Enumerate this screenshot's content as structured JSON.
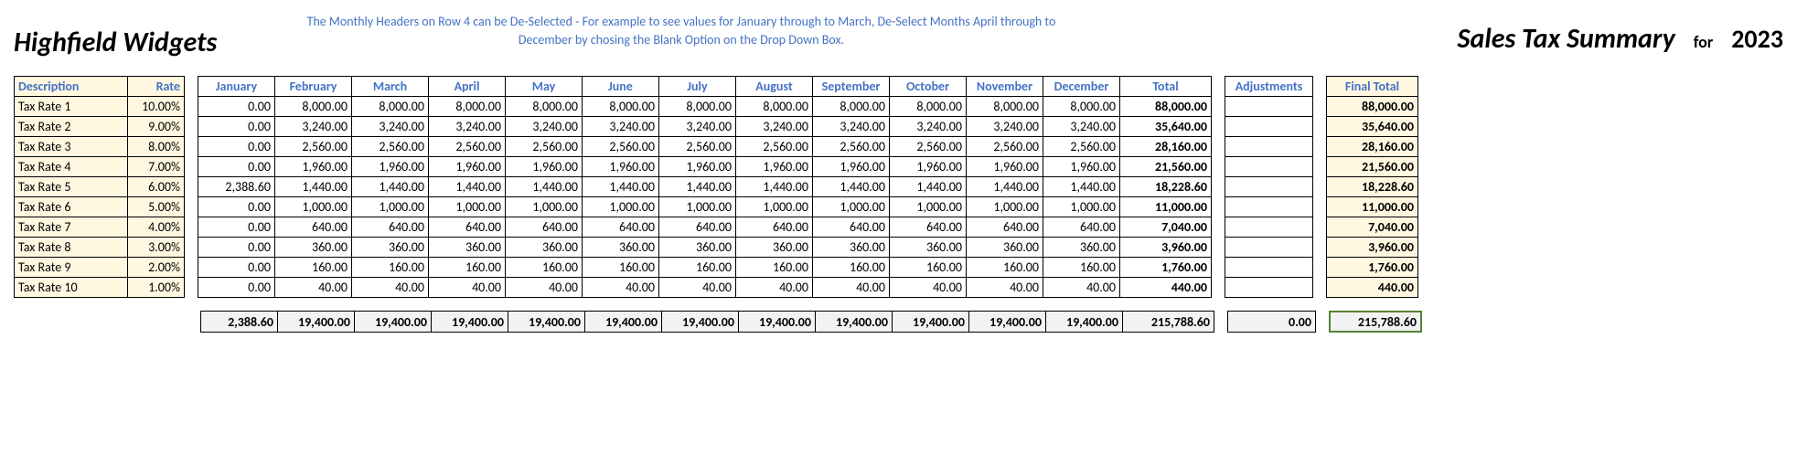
{
  "header": {
    "company": "Highfield Widgets",
    "hint": "The Monthly Headers on Row 4 can be De-Selected - For example to see values for January through to March,  De-Select Months April through to December by chosing the Blank Option on the Drop Down Box.",
    "title": "Sales Tax Summary",
    "for_label": "for",
    "year": "2023"
  },
  "desc_headers": {
    "description": "Description",
    "rate": "Rate"
  },
  "rates": [
    {
      "name": "Tax Rate 1",
      "rate": "10.00%"
    },
    {
      "name": "Tax Rate 2",
      "rate": "9.00%"
    },
    {
      "name": "Tax Rate 3",
      "rate": "8.00%"
    },
    {
      "name": "Tax Rate 4",
      "rate": "7.00%"
    },
    {
      "name": "Tax Rate 5",
      "rate": "6.00%"
    },
    {
      "name": "Tax Rate 6",
      "rate": "5.00%"
    },
    {
      "name": "Tax Rate 7",
      "rate": "4.00%"
    },
    {
      "name": "Tax Rate 8",
      "rate": "3.00%"
    },
    {
      "name": "Tax Rate 9",
      "rate": "2.00%"
    },
    {
      "name": "Tax Rate 10",
      "rate": "1.00%"
    }
  ],
  "month_headers": [
    "January",
    "February",
    "March",
    "April",
    "May",
    "June",
    "July",
    "August",
    "September",
    "October",
    "November",
    "December",
    "Total"
  ],
  "data_rows": [
    [
      "0.00",
      "8,000.00",
      "8,000.00",
      "8,000.00",
      "8,000.00",
      "8,000.00",
      "8,000.00",
      "8,000.00",
      "8,000.00",
      "8,000.00",
      "8,000.00",
      "8,000.00",
      "88,000.00"
    ],
    [
      "0.00",
      "3,240.00",
      "3,240.00",
      "3,240.00",
      "3,240.00",
      "3,240.00",
      "3,240.00",
      "3,240.00",
      "3,240.00",
      "3,240.00",
      "3,240.00",
      "3,240.00",
      "35,640.00"
    ],
    [
      "0.00",
      "2,560.00",
      "2,560.00",
      "2,560.00",
      "2,560.00",
      "2,560.00",
      "2,560.00",
      "2,560.00",
      "2,560.00",
      "2,560.00",
      "2,560.00",
      "2,560.00",
      "28,160.00"
    ],
    [
      "0.00",
      "1,960.00",
      "1,960.00",
      "1,960.00",
      "1,960.00",
      "1,960.00",
      "1,960.00",
      "1,960.00",
      "1,960.00",
      "1,960.00",
      "1,960.00",
      "1,960.00",
      "21,560.00"
    ],
    [
      "2,388.60",
      "1,440.00",
      "1,440.00",
      "1,440.00",
      "1,440.00",
      "1,440.00",
      "1,440.00",
      "1,440.00",
      "1,440.00",
      "1,440.00",
      "1,440.00",
      "1,440.00",
      "18,228.60"
    ],
    [
      "0.00",
      "1,000.00",
      "1,000.00",
      "1,000.00",
      "1,000.00",
      "1,000.00",
      "1,000.00",
      "1,000.00",
      "1,000.00",
      "1,000.00",
      "1,000.00",
      "1,000.00",
      "11,000.00"
    ],
    [
      "0.00",
      "640.00",
      "640.00",
      "640.00",
      "640.00",
      "640.00",
      "640.00",
      "640.00",
      "640.00",
      "640.00",
      "640.00",
      "640.00",
      "7,040.00"
    ],
    [
      "0.00",
      "360.00",
      "360.00",
      "360.00",
      "360.00",
      "360.00",
      "360.00",
      "360.00",
      "360.00",
      "360.00",
      "360.00",
      "360.00",
      "3,960.00"
    ],
    [
      "0.00",
      "160.00",
      "160.00",
      "160.00",
      "160.00",
      "160.00",
      "160.00",
      "160.00",
      "160.00",
      "160.00",
      "160.00",
      "160.00",
      "1,760.00"
    ],
    [
      "0.00",
      "40.00",
      "40.00",
      "40.00",
      "40.00",
      "40.00",
      "40.00",
      "40.00",
      "40.00",
      "40.00",
      "40.00",
      "40.00",
      "440.00"
    ]
  ],
  "adj_header": "Adjustments",
  "adj_rows": [
    "",
    "",
    "",
    "",
    "",
    "",
    "",
    "",
    "",
    ""
  ],
  "final_header": "Final Total",
  "final_rows": [
    "88,000.00",
    "35,640.00",
    "28,160.00",
    "21,560.00",
    "18,228.60",
    "11,000.00",
    "7,040.00",
    "3,960.00",
    "1,760.00",
    "440.00"
  ],
  "sums": [
    "2,388.60",
    "19,400.00",
    "19,400.00",
    "19,400.00",
    "19,400.00",
    "19,400.00",
    "19,400.00",
    "19,400.00",
    "19,400.00",
    "19,400.00",
    "19,400.00",
    "19,400.00",
    "215,788.60"
  ],
  "adj_sum": "0.00",
  "final_sum": "215,788.60"
}
